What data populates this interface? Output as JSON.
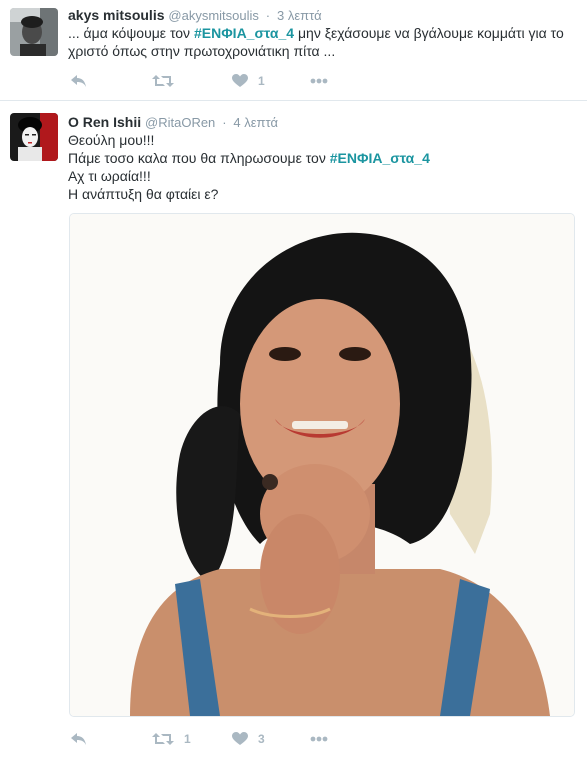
{
  "tweets": [
    {
      "name": "akys mitsoulis",
      "handle": "@akysmitsoulis",
      "separator": "·",
      "time": "3 λεπτά",
      "text_before": "... άμα κόψουμε τον ",
      "hashtag": "#ΕΝΦΙΑ_στα_4",
      "text_after": " μην ξεχάσουμε να βγάλουμε κομμάτι για το χριστό όπως στην πρωτοχρονιάτικη πίτα ...",
      "actions": {
        "reply_icon": "reply-icon",
        "retweet_icon": "retweet-icon",
        "retweet_count": "",
        "like_icon": "heart-icon",
        "like_count": "1",
        "more_icon": "more-icon"
      }
    },
    {
      "name": "O Ren Ishii",
      "handle": "@RitaORen",
      "separator": "·",
      "time": "4 λεπτά",
      "line1": "Θεούλη μου!!!",
      "line2_before": "Πάμε τοσο καλα που θα πληρωσουμε τον ",
      "line2_hashtag": "#ΕΝΦΙΑ_στα_4",
      "line3": "Αχ τι ωραία!!!",
      "line4": "Η ανάπτυξη θα φταίει ε?",
      "media": "photo",
      "actions": {
        "reply_icon": "reply-icon",
        "retweet_icon": "retweet-icon",
        "retweet_count": "1",
        "like_icon": "heart-icon",
        "like_count": "3",
        "more_icon": "more-icon"
      }
    }
  ],
  "colors": {
    "hashtag": "#1b95a0",
    "action": "#aab8c2",
    "muted": "#8899a6",
    "text": "#292f33",
    "divider": "#e1e8ed"
  }
}
